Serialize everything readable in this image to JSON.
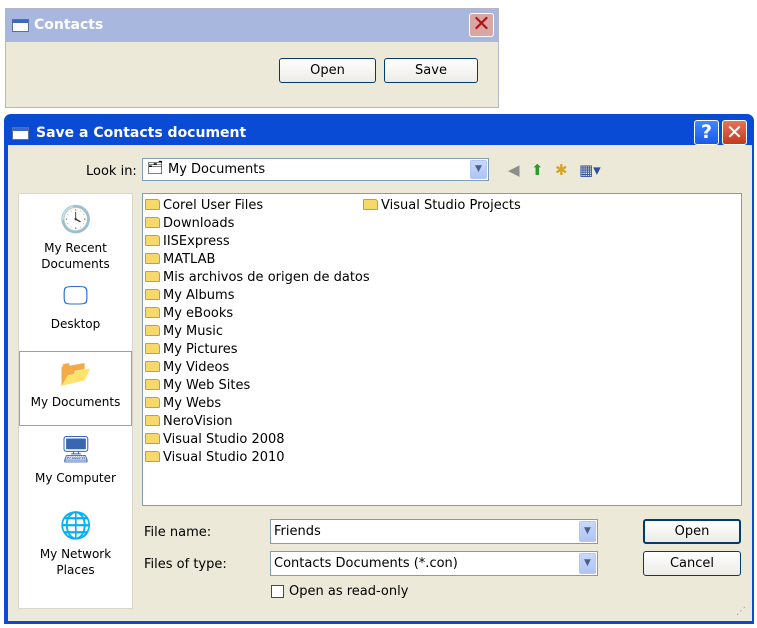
{
  "contacts_window": {
    "title": "Contacts",
    "open_label": "Open",
    "save_label": "Save",
    "close_glyph": "✕"
  },
  "save_dialog": {
    "title": "Save a Contacts  document",
    "help_glyph": "?",
    "close_glyph": "✕",
    "look_in_label": "Look in:",
    "look_in_value": "My Documents",
    "toolbar_icons": [
      "back-icon",
      "up-folder-icon",
      "new-folder-icon",
      "view-menu-icon"
    ],
    "places": [
      {
        "label": "My Recent Documents",
        "icon": "recent-documents-icon"
      },
      {
        "label": "Desktop",
        "icon": "desktop-icon"
      },
      {
        "label": "My Documents",
        "icon": "my-documents-icon"
      },
      {
        "label": "My Computer",
        "icon": "my-computer-icon"
      },
      {
        "label": "My Network Places",
        "icon": "network-places-icon"
      }
    ],
    "files_col1": [
      "Corel User Files",
      "Downloads",
      "IISExpress",
      "MATLAB",
      "Mis archivos de origen de datos",
      "My Albums",
      "My eBooks",
      "My Music",
      "My Pictures",
      "My Videos",
      "My Web Sites",
      "My Webs",
      "NeroVision",
      "Visual Studio 2008",
      "Visual Studio 2010"
    ],
    "files_col2": [
      "Visual Studio Projects"
    ],
    "file_name_label": "File name:",
    "file_name_value": "Friends",
    "files_of_type_label": "Files of type:",
    "files_of_type_value": "Contacts Documents (*.con)",
    "open_button": "Open",
    "cancel_button": "Cancel",
    "read_only_label": "Open as read-only"
  }
}
